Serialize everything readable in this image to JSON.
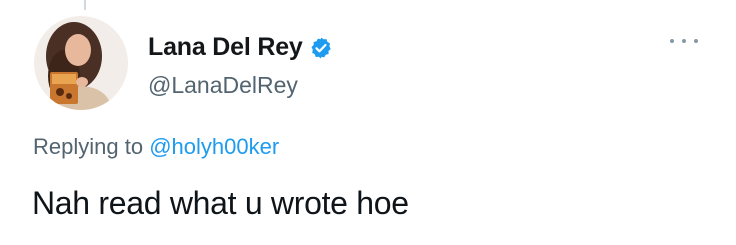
{
  "tweet": {
    "display_name": "Lana Del Rey",
    "handle": "@LanaDelRey",
    "verified": true,
    "replying_prefix": "Replying to",
    "replying_to": "@holyh00ker",
    "text": "Nah read what u wrote hoe"
  },
  "icons": {
    "verified": "verified-badge-icon",
    "more": "more-options-icon",
    "avatar": "profile-avatar"
  },
  "colors": {
    "link": "#1d9bf0",
    "secondary_text": "#536471",
    "verified": "#1d9bf0"
  }
}
